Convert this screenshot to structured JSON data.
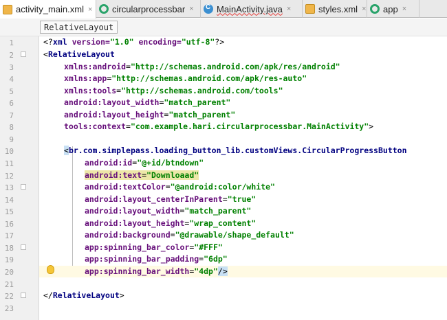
{
  "tabs": [
    {
      "label": "activity_main.xml",
      "icon": "xml-file-icon",
      "active": true
    },
    {
      "label": "circularprocessbar",
      "icon": "module-icon",
      "active": false
    },
    {
      "label": "MainActivity.java",
      "icon": "java-class-icon",
      "active": false
    },
    {
      "label": "styles.xml",
      "icon": "xml-file-icon",
      "active": false
    },
    {
      "label": "app",
      "icon": "module-icon",
      "active": false
    }
  ],
  "close_glyph": "×",
  "breadcrumb": "RelativeLayout",
  "line_numbers": [
    "1",
    "2",
    "3",
    "4",
    "5",
    "6",
    "7",
    "8",
    "9",
    "10",
    "11",
    "12",
    "13",
    "14",
    "15",
    "16",
    "17",
    "18",
    "19",
    "20",
    "21",
    "22",
    "23"
  ],
  "code": {
    "l1": {
      "open": "<?",
      "tag": "xml",
      "attr1": " version=",
      "val1": "\"1.0\"",
      "attr2": " encoding=",
      "val2": "\"utf-8\"",
      "close": "?>"
    },
    "l2": {
      "open": "<",
      "tag": "RelativeLayout"
    },
    "l3": {
      "ns": "xmlns:android",
      "eq": "=",
      "val": "\"http://schemas.android.com/apk/res/android\""
    },
    "l4": {
      "ns": "xmlns:app",
      "eq": "=",
      "val": "\"http://schemas.android.com/apk/res-auto\""
    },
    "l5": {
      "ns": "xmlns:tools",
      "eq": "=",
      "val": "\"http://schemas.android.com/tools\""
    },
    "l6": {
      "attr": "android:layout_width",
      "eq": "=",
      "val": "\"match_parent\""
    },
    "l7": {
      "attr": "android:layout_height",
      "eq": "=",
      "val": "\"match_parent\""
    },
    "l8": {
      "attr": "tools:context",
      "eq": "=",
      "val": "\"com.example.hari.circularprocessbar.MainActivity\"",
      "close": ">"
    },
    "l10": {
      "open": "<",
      "tag": "br.com.simplepass.loading_button_lib.customViews.CircularProgressButton"
    },
    "l11": {
      "attr": "android:id",
      "eq": "=",
      "val": "\"@+id/btndown\""
    },
    "l12": {
      "attr": "android:text",
      "eq": "=",
      "val": "\"Downloaad\""
    },
    "l13": {
      "attr": "android:textColor",
      "eq": "=",
      "val": "\"@android:color/white\""
    },
    "l14": {
      "attr": "android:layout_centerInParent",
      "eq": "=",
      "val": "\"true\""
    },
    "l15": {
      "attr": "android:layout_width",
      "eq": "=",
      "val": "\"match_parent\""
    },
    "l16": {
      "attr": "android:layout_height",
      "eq": "=",
      "val": "\"wrap_content\""
    },
    "l17": {
      "attr": "android:background",
      "eq": "=",
      "val": "\"@drawable/shape_default\""
    },
    "l18": {
      "attr": "app:spinning_bar_color",
      "eq": "=",
      "val": "\"#FFF\""
    },
    "l19": {
      "attr": "app:spinning_bar_padding",
      "eq": "=",
      "val": "\"6dp\""
    },
    "l20": {
      "attr": "app:spinning_bar_width",
      "eq": "=",
      "val": "\"4dp\"",
      "close": "/>"
    },
    "l22": {
      "open": "</",
      "tag": "RelativeLayout",
      "close": ">"
    }
  },
  "colors": {
    "tag": "#000080",
    "attribute": "#660e7a",
    "value": "#008000",
    "caret_line": "#fffae3",
    "text_highlight": "#ede7a8"
  }
}
